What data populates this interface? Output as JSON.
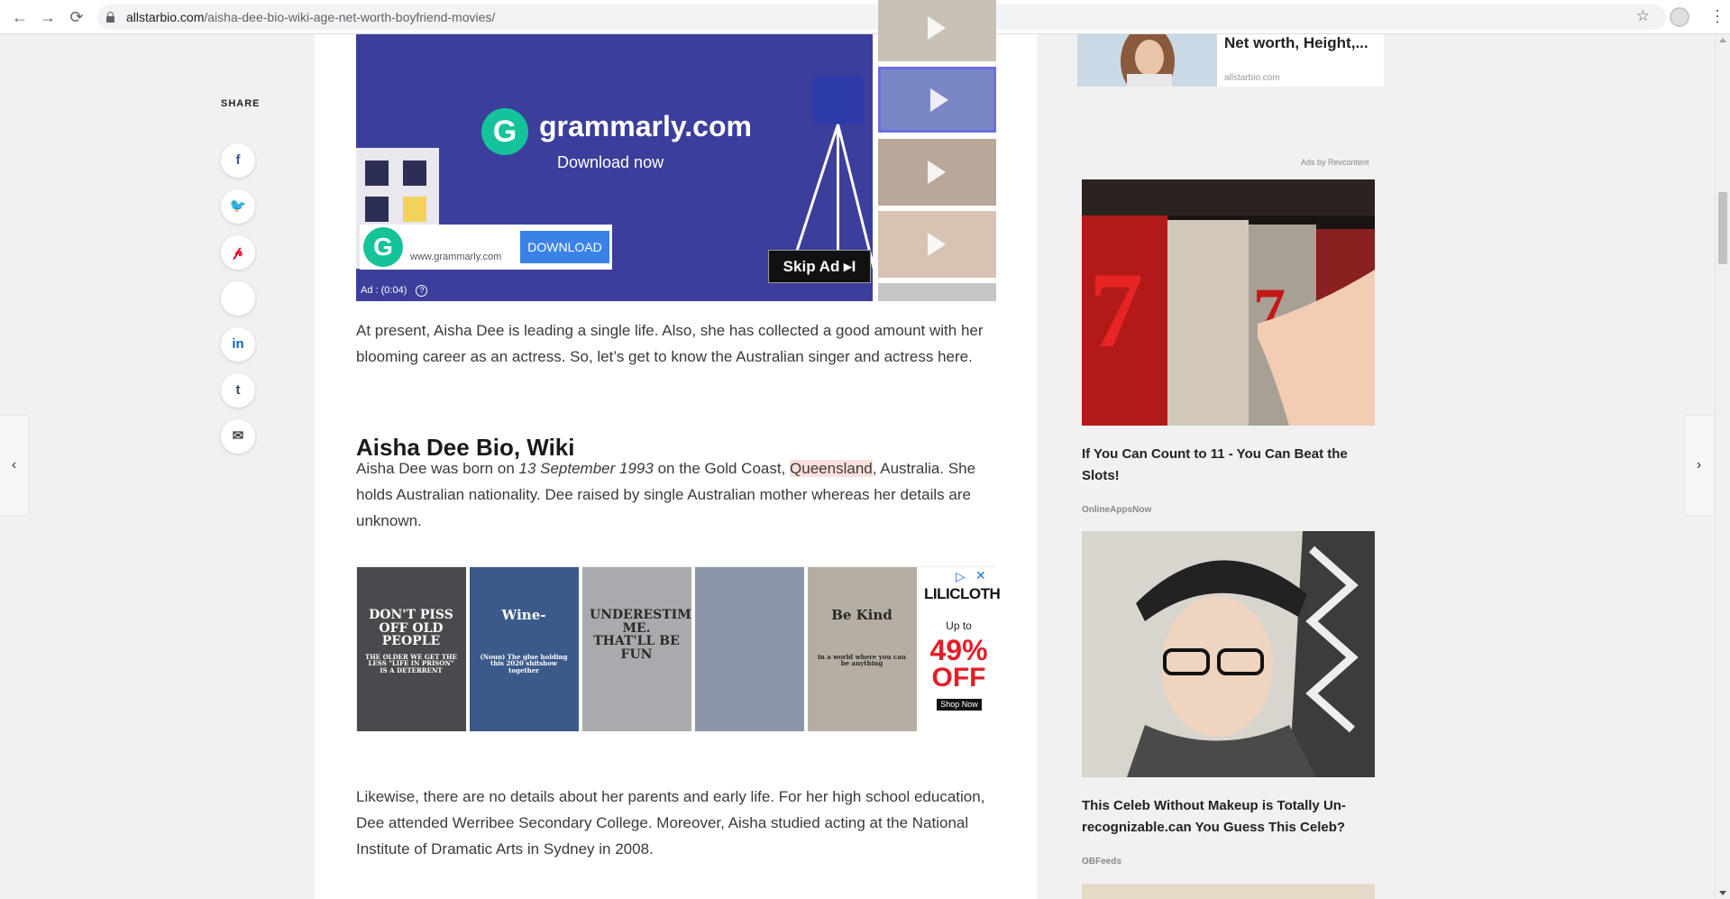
{
  "browser": {
    "back_glyph": "←",
    "forward_glyph": "→",
    "reload_glyph": "⟳",
    "url_domain": "allstarbio.com",
    "url_path": "/aisha-dee-bio-wiki-age-net-worth-boyfriend-movies/",
    "star_glyph": "☆",
    "menu_glyph": "⋮"
  },
  "share": {
    "title": "SHARE",
    "buttons": [
      {
        "name": "facebook",
        "glyph": "f",
        "color": "#3b5998"
      },
      {
        "name": "twitter",
        "glyph": "🐦",
        "color": "#1da1f2"
      },
      {
        "name": "pinterest",
        "glyph": "𝓅",
        "color": "#e60023"
      },
      {
        "name": "blank",
        "glyph": "",
        "color": "#cccccc"
      },
      {
        "name": "linkedin",
        "glyph": "in",
        "color": "#0a66c2"
      },
      {
        "name": "tumblr",
        "glyph": "t",
        "color": "#35465c"
      },
      {
        "name": "email",
        "glyph": "✉",
        "color": "#444444"
      }
    ]
  },
  "video_ad": {
    "brand": "grammarly.com",
    "subtitle": "Download now",
    "logo_letter": "G",
    "cta_url": "www.grammarly.com",
    "cta_button": "DOWNLOAD",
    "skip": "Skip Ad ▸I",
    "timer": "Ad : (0:04)",
    "help_glyph": "?"
  },
  "article": {
    "intro_paragraph": "At present, Aisha Dee is leading a single life. Also, she has collected a good amount with her blooming career as an actress. So, let’s get to know the Australian singer and actress here.",
    "bio_heading": "Aisha Dee Bio, Wiki",
    "bio_p1_a": "Aisha Dee was born on ",
    "bio_p1_date": "13 September 1993",
    "bio_p1_b": " on the Gold Coast, ",
    "bio_p1_place": "Queensland",
    "bio_p1_c": ", Australia. She holds Australian nationality. Dee raised by single Australian mother whereas her details are unknown.",
    "bio_p2": "Likewise, there are no details about her parents and early life. For her high school education, Dee attended Werribee Secondary College. Moreover, Aisha studied acting at the National Institute of Dramatic Arts in Sydney in 2008."
  },
  "banner_ad": {
    "shirts": [
      {
        "text": "DON'T PISS OFF OLD PEOPLE",
        "fine": "THE OLDER WE GET THE LESS \"LIFE IN PRISON\" IS A DETERRENT",
        "bg": "#4a4a4e",
        "fg": "#ffffff"
      },
      {
        "text": "Wine-",
        "fine": "(Noun) The glue holding this 2020 shitshow together",
        "bg": "#3b5a8a",
        "fg": "#ffffff"
      },
      {
        "text": "UNDERESTIMATE ME. THAT'LL BE FUN",
        "fine": "",
        "bg": "#a9aaae",
        "fg": "#2a2a2a"
      },
      {
        "text": "",
        "fine": "",
        "bg": "#8c96a8",
        "fg": "#2a2a2a"
      },
      {
        "text": "Be Kind",
        "fine": "in a world where you can be anything",
        "bg": "#b6aea2",
        "fg": "#2a2a2a"
      }
    ],
    "brand": "LILICLOTH",
    "up_to": "Up to",
    "percent": "49%",
    "off": "OFF",
    "shop": "Shop Now",
    "adchoice_glyph": "▷",
    "close_glyph": "✕"
  },
  "sidebar": {
    "related_title": "Net worth, Height,...",
    "related_source": "allstarbio.com",
    "ads_by": "Ads by Revcontent",
    "ads": [
      {
        "title": "If You Can Count to 11 - You Can Beat the Slots!",
        "source": "OnlineAppsNow"
      },
      {
        "title": "This Celeb Without Makeup is Totally Un-recognizable.can You Guess This Celeb?",
        "source": "OBFeeds"
      }
    ]
  },
  "nav": {
    "prev_glyph": "‹",
    "next_glyph": "›"
  }
}
